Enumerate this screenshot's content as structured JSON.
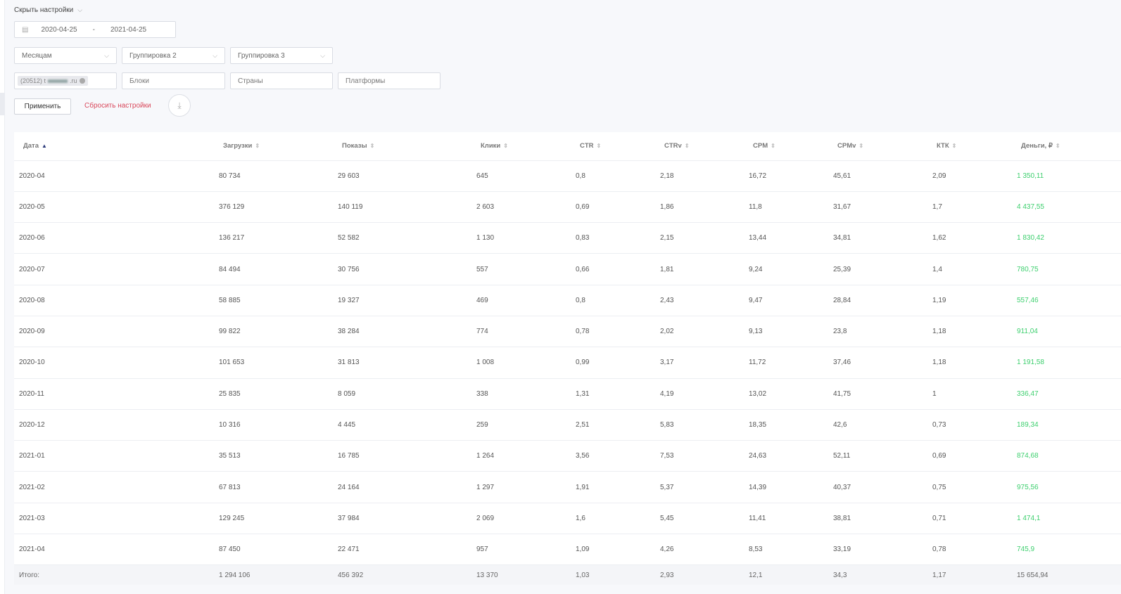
{
  "settings": {
    "toggle_label": "Скрыть настройки",
    "date_from": "2020-04-25",
    "date_sep": "-",
    "date_to": "2021-04-25",
    "group1": "Месяцам",
    "group2": "Группировка 2",
    "group3": "Группировка 3",
    "site_tag": "(20512) t",
    "site_tag_suffix": ".ru",
    "blocks_placeholder": "Блоки",
    "countries_placeholder": "Страны",
    "platforms_placeholder": "Платформы",
    "apply_label": "Применить",
    "reset_label": "Сбросить настройки"
  },
  "table": {
    "columns": [
      "Дата",
      "Загрузки",
      "Показы",
      "Клики",
      "CTR",
      "CTRv",
      "CPM",
      "CPMv",
      "КТК",
      "Деньги, ₽"
    ],
    "rows": [
      [
        "2020-04",
        "80 734",
        "29 603",
        "645",
        "0,8",
        "2,18",
        "16,72",
        "45,61",
        "2,09",
        "1 350,11"
      ],
      [
        "2020-05",
        "376 129",
        "140 119",
        "2 603",
        "0,69",
        "1,86",
        "11,8",
        "31,67",
        "1,7",
        "4 437,55"
      ],
      [
        "2020-06",
        "136 217",
        "52 582",
        "1 130",
        "0,83",
        "2,15",
        "13,44",
        "34,81",
        "1,62",
        "1 830,42"
      ],
      [
        "2020-07",
        "84 494",
        "30 756",
        "557",
        "0,66",
        "1,81",
        "9,24",
        "25,39",
        "1,4",
        "780,75"
      ],
      [
        "2020-08",
        "58 885",
        "19 327",
        "469",
        "0,8",
        "2,43",
        "9,47",
        "28,84",
        "1,19",
        "557,46"
      ],
      [
        "2020-09",
        "99 822",
        "38 284",
        "774",
        "0,78",
        "2,02",
        "9,13",
        "23,8",
        "1,18",
        "911,04"
      ],
      [
        "2020-10",
        "101 653",
        "31 813",
        "1 008",
        "0,99",
        "3,17",
        "11,72",
        "37,46",
        "1,18",
        "1 191,58"
      ],
      [
        "2020-11",
        "25 835",
        "8 059",
        "338",
        "1,31",
        "4,19",
        "13,02",
        "41,75",
        "1",
        "336,47"
      ],
      [
        "2020-12",
        "10 316",
        "4 445",
        "259",
        "2,51",
        "5,83",
        "18,35",
        "42,6",
        "0,73",
        "189,34"
      ],
      [
        "2021-01",
        "35 513",
        "16 785",
        "1 264",
        "3,56",
        "7,53",
        "24,63",
        "52,11",
        "0,69",
        "874,68"
      ],
      [
        "2021-02",
        "67 813",
        "24 164",
        "1 297",
        "1,91",
        "5,37",
        "14,39",
        "40,37",
        "0,75",
        "975,56"
      ],
      [
        "2021-03",
        "129 245",
        "37 984",
        "2 069",
        "1,6",
        "5,45",
        "11,41",
        "38,81",
        "0,71",
        "1 474,1"
      ],
      [
        "2021-04",
        "87 450",
        "22 471",
        "957",
        "1,09",
        "4,26",
        "8,53",
        "33,19",
        "0,78",
        "745,9"
      ]
    ],
    "total": [
      "Итого:",
      "1 294 106",
      "456 392",
      "13 370",
      "1,03",
      "2,93",
      "12,1",
      "34,3",
      "1,17",
      "15 654,94"
    ]
  },
  "colors": {
    "money": "#3dcf6e",
    "reset": "#d9475a"
  }
}
